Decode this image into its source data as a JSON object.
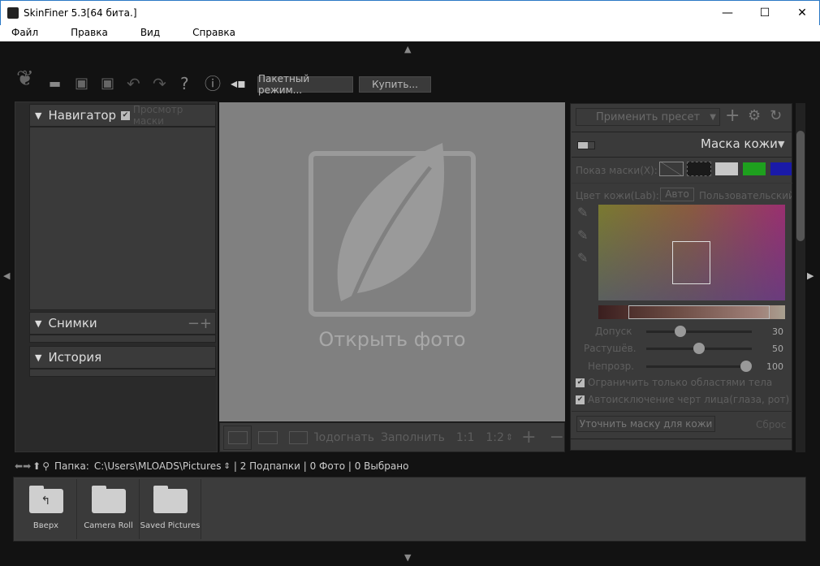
{
  "window": {
    "title": "SkinFiner 5.3[64 бита.]"
  },
  "menu": [
    "Файл",
    "Правка",
    "Вид",
    "Справка"
  ],
  "toolbar": {
    "batch_label": "Пакетный режим...",
    "buy_label": "Купить...",
    "icons": [
      "logo-leaf-icon",
      "open-folder-icon",
      "save-icon",
      "save-as-icon",
      "undo-icon",
      "redo-icon",
      "help-icon",
      "info-icon",
      "plugin-icon"
    ]
  },
  "left_panel": {
    "navigator": "Навигатор",
    "mask_preview": "Просмотр маски",
    "mask_preview_checked": true,
    "snapshots": "Снимки",
    "history": "История"
  },
  "canvas": {
    "open_photo": "Открыть фото"
  },
  "canvas_bar": {
    "fit": "Подогнать",
    "fill": "Заполнить",
    "ratio1": "1:1",
    "ratio2": "1:2"
  },
  "right_panel": {
    "preset": "Применить пресет",
    "skin_mask": "Маска кожи",
    "mask_show_label": "Показ маски(X):",
    "mask_colors": [
      "#1a1a1a",
      "#c8c8c8",
      "#1ea01e",
      "#1a1aa8"
    ],
    "skin_color_label": "Цвет кожи(Lab):",
    "auto": "Авто",
    "custom": "Пользовательский",
    "sliders": [
      {
        "label": "Допуск",
        "value": 30
      },
      {
        "label": "Растушёв.",
        "value": 50
      },
      {
        "label": "Непрозр.",
        "value": 100
      }
    ],
    "check1": "Ограничить только областями тела",
    "check2": "Автоисключение черт лица(глаза, рот)",
    "refine": "Уточнить маску для кожи",
    "reset": "Сброс"
  },
  "path": {
    "label": "Папка:",
    "value": "C:\\Users\\MLOADS\\Pictures",
    "stats": "| 2 Подпапки | 0 Фото | 0 Выбрано"
  },
  "folders": [
    "Вверх",
    "Camera Roll",
    "Saved Pictures"
  ]
}
